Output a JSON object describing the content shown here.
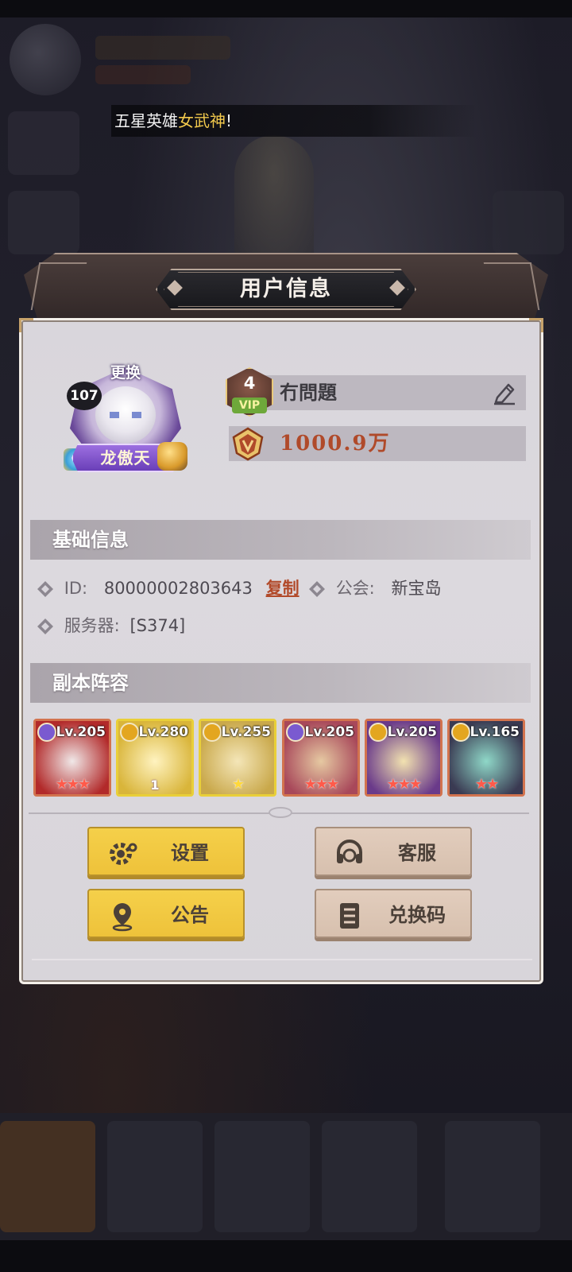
{
  "marquee": {
    "prefix": "五星英雄",
    "highlight": "女武神",
    "suffix": "!"
  },
  "dialog": {
    "title": "用户信息",
    "avatar": {
      "change_label": "更换",
      "level": "107",
      "title_badge": "龙傲天"
    },
    "vip": {
      "level": "4",
      "label": "VIP"
    },
    "player_name": "冇問題",
    "gold": "1000.9万"
  },
  "basic_info": {
    "header": "基础信息",
    "id_label": "ID:",
    "id_value": "80000002803643",
    "copy_label": "复制",
    "guild_label": "公会:",
    "guild_value": "新宝岛",
    "server_label": "服务器:",
    "server_value": "[S374]"
  },
  "lineup": {
    "header": "副本阵容",
    "heroes": [
      {
        "level": "Lv.205",
        "stars": "★★★",
        "frame": "red",
        "class_color": "#7a5ad0",
        "portrait": [
          "#b22a2a",
          "#f0e8e8"
        ]
      },
      {
        "level": "Lv.280",
        "stars": "1",
        "frame": "gold",
        "class_color": "#e3a61f",
        "portrait": [
          "#d9b53a",
          "#fff3c0"
        ]
      },
      {
        "level": "Lv.255",
        "stars": "★",
        "frame": "gold",
        "class_color": "#e3a61f",
        "portrait": [
          "#c9a84a",
          "#f4e6b8"
        ]
      },
      {
        "level": "Lv.205",
        "stars": "★★★",
        "frame": "red",
        "class_color": "#7a5ad0",
        "portrait": [
          "#a8485a",
          "#e6c9a2"
        ]
      },
      {
        "level": "Lv.205",
        "stars": "★★★",
        "frame": "red",
        "class_color": "#e3a61f",
        "portrait": [
          "#6a3a8a",
          "#f2e2b0"
        ]
      },
      {
        "level": "Lv.165",
        "stars": "★★",
        "frame": "red",
        "class_color": "#e3a61f",
        "portrait": [
          "#3a3a52",
          "#8fd8c8"
        ]
      }
    ]
  },
  "buttons": {
    "settings": "设置",
    "support": "客服",
    "announcement": "公告",
    "redeem": "兑换码"
  },
  "colors": {
    "accent_yellow": "#f2c94c",
    "copy_link": "#b24a2a",
    "gold_text": "#b04a2a"
  }
}
